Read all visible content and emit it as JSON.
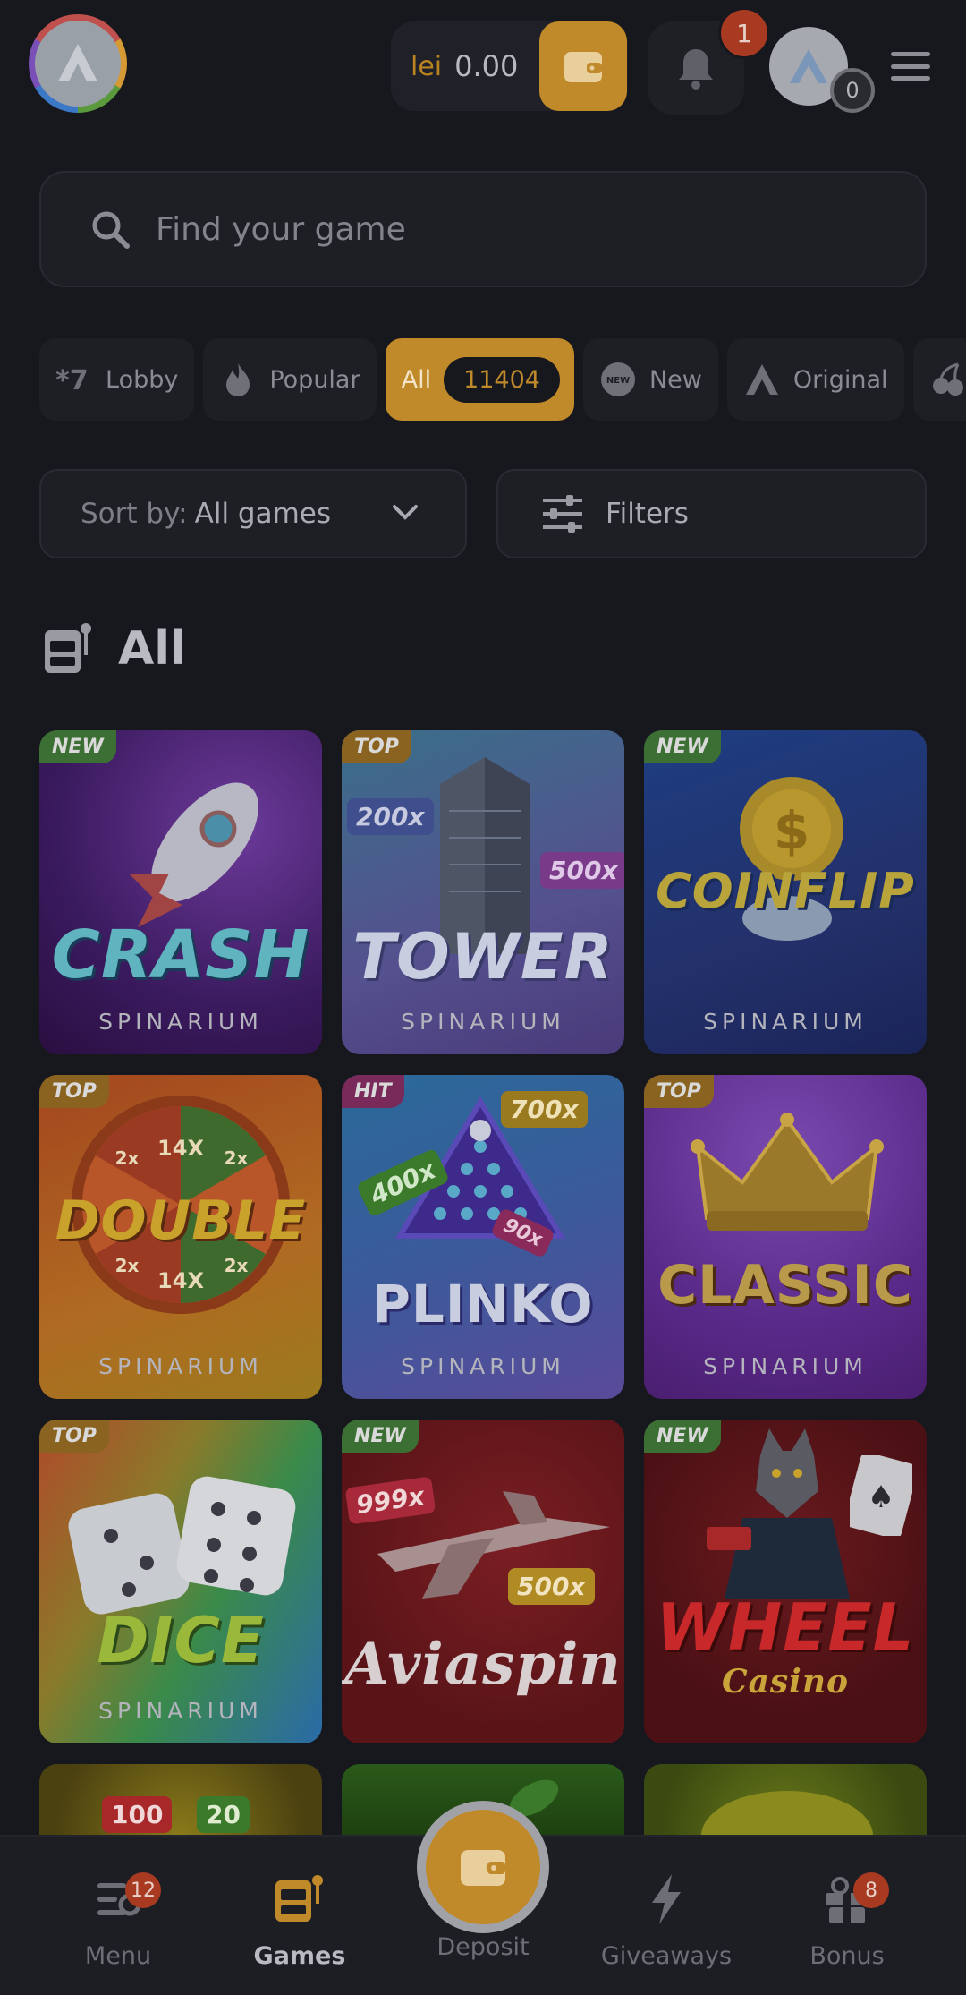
{
  "header": {
    "currency": "lei",
    "balance": "0.00",
    "notifications_count": "1",
    "avatar_count": "0"
  },
  "search": {
    "placeholder": "Find your game"
  },
  "tabs": [
    {
      "label": "Lobby",
      "icon": "sevens-icon"
    },
    {
      "label": "Popular",
      "icon": "fire-icon"
    },
    {
      "label": "All",
      "count": "11404",
      "icon": ""
    },
    {
      "label": "New",
      "icon": "new-badge-icon"
    },
    {
      "label": "Original",
      "icon": "original-logo-icon"
    }
  ],
  "sort": {
    "label": "Sort by:",
    "value": "All games"
  },
  "filters": {
    "label": "Filters"
  },
  "section": {
    "title": "All"
  },
  "games": [
    {
      "title": "CRASH",
      "provider": "SPINARIUM",
      "badge": "NEW"
    },
    {
      "title": "TOWER",
      "provider": "SPINARIUM",
      "badge": "TOP",
      "multipliers": [
        "200x",
        "500x"
      ]
    },
    {
      "title": "COINFLIP",
      "provider": "SPINARIUM",
      "badge": "NEW"
    },
    {
      "title": "DOUBLE",
      "provider": "SPINARIUM",
      "badge": "TOP",
      "multipliers": [
        "14X",
        "2x",
        "2x",
        "2x",
        "2x",
        "14X"
      ]
    },
    {
      "title": "PLINKO",
      "provider": "SPINARIUM",
      "badge": "HIT",
      "multipliers": [
        "700x",
        "400x",
        "90x"
      ]
    },
    {
      "title": "CLASSIC",
      "provider": "SPINARIUM",
      "badge": "TOP"
    },
    {
      "title": "DICE",
      "provider": "SPINARIUM",
      "badge": "TOP"
    },
    {
      "title": "Aviaspin",
      "provider": "",
      "badge": "NEW",
      "multipliers": [
        "999x",
        "500x"
      ]
    },
    {
      "title": "WHEEL",
      "subtitle": "Casino",
      "provider": "",
      "badge": "NEW"
    }
  ],
  "partial_row": {
    "labels": [
      "100",
      "20"
    ]
  },
  "bottom_nav": {
    "menu": {
      "label": "Menu",
      "badge": "12"
    },
    "games": {
      "label": "Games"
    },
    "deposit": {
      "label": "Deposit"
    },
    "giveaways": {
      "label": "Giveaways"
    },
    "bonus": {
      "label": "Bonus",
      "badge": "8"
    }
  },
  "colors": {
    "background": "#17181d",
    "accent": "#c08a2a",
    "badge_red": "#a83a22",
    "badge_new": "#3c6f33",
    "badge_top": "#8a6320"
  }
}
